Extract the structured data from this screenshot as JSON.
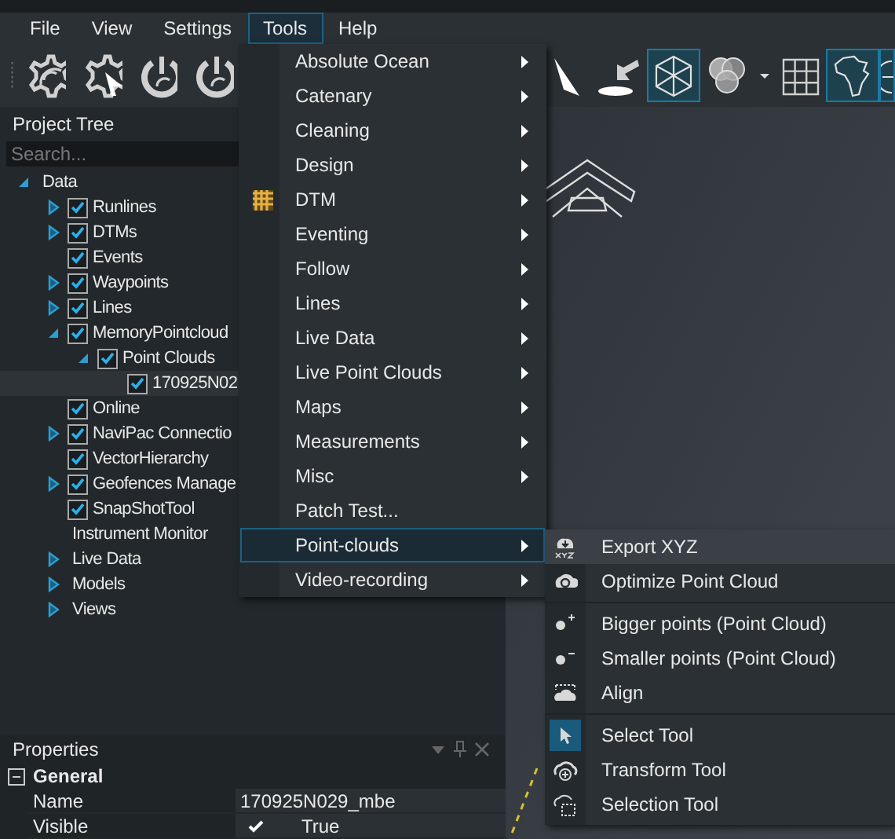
{
  "menubar": [
    {
      "label": "File",
      "selected": false
    },
    {
      "label": "View",
      "selected": false
    },
    {
      "label": "Settings",
      "selected": false
    },
    {
      "label": "Tools",
      "selected": true
    },
    {
      "label": "Help",
      "selected": false
    }
  ],
  "toolbar": {
    "left": [
      {
        "kind": "gear-signal",
        "active": false
      },
      {
        "kind": "gear-cursor",
        "active": false
      },
      {
        "kind": "power-signal",
        "active": false
      },
      {
        "kind": "power-signal",
        "active": false
      }
    ],
    "right": [
      {
        "kind": "triangle",
        "active": false
      },
      {
        "kind": "landing",
        "active": false
      },
      {
        "kind": "cube",
        "active": true
      },
      {
        "kind": "circles",
        "active": false
      },
      {
        "kind": "caret",
        "active": false
      },
      {
        "kind": "grid",
        "active": false
      },
      {
        "kind": "africa",
        "active": true
      },
      {
        "kind": "globe",
        "active": true
      }
    ]
  },
  "project_tree": {
    "title": "Project Tree",
    "search": {
      "placeholder": "Search..."
    },
    "items": [
      {
        "label": "Data",
        "kind": "plain",
        "expanded": true,
        "selected": false,
        "children": [
          {
            "label": "Runlines",
            "kind": "checkbox",
            "checked": true,
            "expanded": false,
            "selected": false
          },
          {
            "label": "DTMs",
            "kind": "checkbox",
            "checked": true,
            "expanded": false,
            "selected": false
          },
          {
            "label": "Events",
            "kind": "checkbox",
            "checked": true,
            "selected": false
          },
          {
            "label": "Waypoints",
            "kind": "checkbox",
            "checked": true,
            "expanded": false,
            "selected": false
          },
          {
            "label": "Lines",
            "kind": "checkbox",
            "checked": true,
            "expanded": false,
            "selected": false
          },
          {
            "label": "MemoryPointcloud",
            "kind": "checkbox",
            "checked": true,
            "expanded": true,
            "selected": false,
            "children": [
              {
                "label": "Point Clouds",
                "kind": "checkbox",
                "checked": true,
                "expanded": true,
                "selected": false,
                "children": [
                  {
                    "label": "170925N02",
                    "kind": "checkbox",
                    "checked": true,
                    "selected": true
                  }
                ]
              }
            ]
          },
          {
            "label": "Online",
            "kind": "checkbox",
            "checked": true,
            "selected": false
          },
          {
            "label": "NaviPac Connectio",
            "kind": "checkbox",
            "checked": true,
            "expanded": false,
            "selected": false
          },
          {
            "label": "VectorHierarchy",
            "kind": "checkbox",
            "checked": true,
            "selected": false
          },
          {
            "label": "Geofences Manage",
            "kind": "checkbox",
            "checked": true,
            "expanded": false,
            "selected": false
          },
          {
            "label": "SnapShotTool",
            "kind": "checkbox",
            "checked": true,
            "selected": false
          },
          {
            "label": "Instrument Monitor",
            "kind": "plain",
            "selected": false
          },
          {
            "label": "Live Data",
            "kind": "plain",
            "expanded": false,
            "selected": false
          },
          {
            "label": "Models",
            "kind": "plain",
            "expanded": false,
            "selected": false
          },
          {
            "label": "Views",
            "kind": "plain",
            "expanded": false,
            "selected": false
          }
        ]
      }
    ]
  },
  "properties": {
    "title": "Properties",
    "sections": [
      {
        "label": "General",
        "expanded": true,
        "rows": [
          {
            "name": "Name",
            "value": "170925N029_mbe",
            "kind": "text"
          },
          {
            "name": "Visible",
            "value": "True",
            "kind": "bool",
            "checked": true
          }
        ]
      }
    ]
  },
  "tools_menu": {
    "items": [
      {
        "label": "Absolute Ocean",
        "submenu": true,
        "highlighted": false,
        "kind": "plain"
      },
      {
        "label": "Catenary",
        "submenu": true,
        "highlighted": false,
        "kind": "plain"
      },
      {
        "label": "Cleaning",
        "submenu": true,
        "highlighted": false,
        "kind": "plain"
      },
      {
        "label": "Design",
        "submenu": true,
        "highlighted": false,
        "kind": "plain"
      },
      {
        "label": "DTM",
        "submenu": true,
        "highlighted": false,
        "kind": "grid"
      },
      {
        "label": "Eventing",
        "submenu": true,
        "highlighted": false,
        "kind": "plain"
      },
      {
        "label": "Follow",
        "submenu": true,
        "highlighted": false,
        "kind": "plain"
      },
      {
        "label": "Lines",
        "submenu": true,
        "highlighted": false,
        "kind": "plain"
      },
      {
        "label": "Live Data",
        "submenu": true,
        "highlighted": false,
        "kind": "plain"
      },
      {
        "label": "Live Point Clouds",
        "submenu": true,
        "highlighted": false,
        "kind": "plain"
      },
      {
        "label": "Maps",
        "submenu": true,
        "highlighted": false,
        "kind": "plain"
      },
      {
        "label": "Measurements",
        "submenu": true,
        "highlighted": false,
        "kind": "plain"
      },
      {
        "label": "Misc",
        "submenu": true,
        "highlighted": false,
        "kind": "plain"
      },
      {
        "label": "Patch Test...",
        "submenu": false,
        "highlighted": false,
        "kind": "plain"
      },
      {
        "label": "Point-clouds",
        "submenu": true,
        "highlighted": true,
        "kind": "plain"
      },
      {
        "label": "Video-recording",
        "submenu": true,
        "highlighted": false,
        "kind": "plain"
      }
    ]
  },
  "point_clouds_submenu": {
    "groups": [
      [
        {
          "label": "Export XYZ",
          "kind": "export",
          "highlighted": true,
          "active": false
        },
        {
          "label": "Optimize Point Cloud",
          "kind": "optimize",
          "highlighted": false,
          "active": false
        }
      ],
      [
        {
          "label": "Bigger points (Point Cloud)",
          "kind": "bigger",
          "highlighted": false,
          "active": false
        },
        {
          "label": "Smaller points (Point Cloud)",
          "kind": "smaller",
          "highlighted": false,
          "active": false
        },
        {
          "label": "Align",
          "kind": "align",
          "highlighted": false,
          "active": false
        }
      ],
      [
        {
          "label": "Select Tool",
          "kind": "select",
          "highlighted": false,
          "active": true
        },
        {
          "label": "Transform Tool",
          "kind": "transform",
          "highlighted": false,
          "active": false
        },
        {
          "label": "Selection Tool",
          "kind": "selection",
          "highlighted": false,
          "active": false
        }
      ]
    ]
  }
}
